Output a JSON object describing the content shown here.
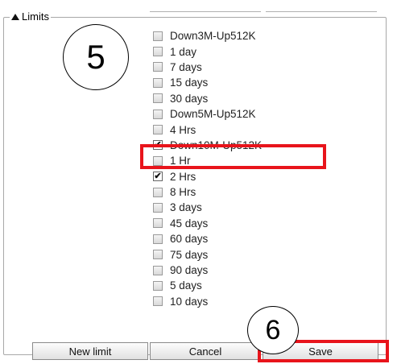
{
  "legend": {
    "label": "Limits",
    "collapse_icon": "triangle-up-icon"
  },
  "limits": [
    {
      "label": "Down3M-Up512K",
      "checked": false
    },
    {
      "label": "1 day",
      "checked": false
    },
    {
      "label": "7 days",
      "checked": false
    },
    {
      "label": "15 days",
      "checked": false
    },
    {
      "label": "30 days",
      "checked": false
    },
    {
      "label": "Down5M-Up512K",
      "checked": false
    },
    {
      "label": "4 Hrs",
      "checked": false
    },
    {
      "label": "Down10M-Up512K",
      "checked": true
    },
    {
      "label": "1 Hr",
      "checked": false
    },
    {
      "label": "2 Hrs",
      "checked": true
    },
    {
      "label": "8 Hrs",
      "checked": false
    },
    {
      "label": "3 days",
      "checked": false
    },
    {
      "label": "45 days",
      "checked": false
    },
    {
      "label": "60 days",
      "checked": false
    },
    {
      "label": "75 days",
      "checked": false
    },
    {
      "label": "90 days",
      "checked": false
    },
    {
      "label": "5 days",
      "checked": false
    },
    {
      "label": "10 days",
      "checked": false
    }
  ],
  "buttons": {
    "new_limit": "New limit",
    "cancel": "Cancel",
    "save": "Save"
  },
  "annotations": {
    "step_5": "5",
    "step_6": "6",
    "highlight_color": "#e8141b"
  }
}
